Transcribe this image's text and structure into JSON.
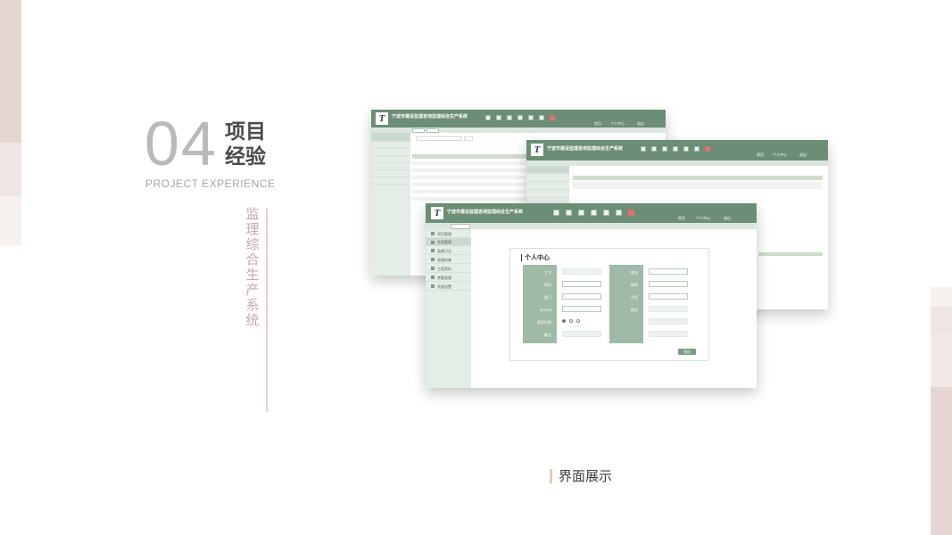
{
  "heading": {
    "number": "04",
    "title_cn": "项目经验",
    "subtitle_en": "PROJECT EXPERIENCE",
    "vertical_label": "监理综合生产系统"
  },
  "caption": "界面展示",
  "app": {
    "title": "宁波市建设监理咨询监理综合生产系统",
    "logo": "T",
    "header_menu": [
      "首页",
      "个人中心",
      "退出"
    ],
    "sidebar_items": [
      "项目管理",
      "合同管理",
      "监理日志",
      "质量检查",
      "工程资料",
      "考勤管理",
      "系统设置"
    ],
    "profile": {
      "panel_title": "个人中心",
      "fields_left": [
        {
          "label": "工号",
          "value": ""
        },
        {
          "label": "性别",
          "value": ""
        },
        {
          "label": "部门",
          "value": ""
        },
        {
          "label": "E-mail",
          "value": ""
        },
        {
          "label": "是否在职",
          "value": ""
        },
        {
          "label": "备注",
          "value": ""
        }
      ],
      "fields_right": [
        {
          "label": "姓名",
          "value": ""
        },
        {
          "label": "职称",
          "value": ""
        },
        {
          "label": "手机",
          "value": ""
        },
        {
          "label": "职位",
          "value": ""
        },
        {
          "label": "",
          "value": ""
        },
        {
          "label": "",
          "value": ""
        }
      ],
      "save_label": "保存"
    }
  },
  "colors": {
    "header_green": "#6c8d76",
    "sidebar_bg": "#e4ede6",
    "accent_pink": "#e6d6d3"
  }
}
